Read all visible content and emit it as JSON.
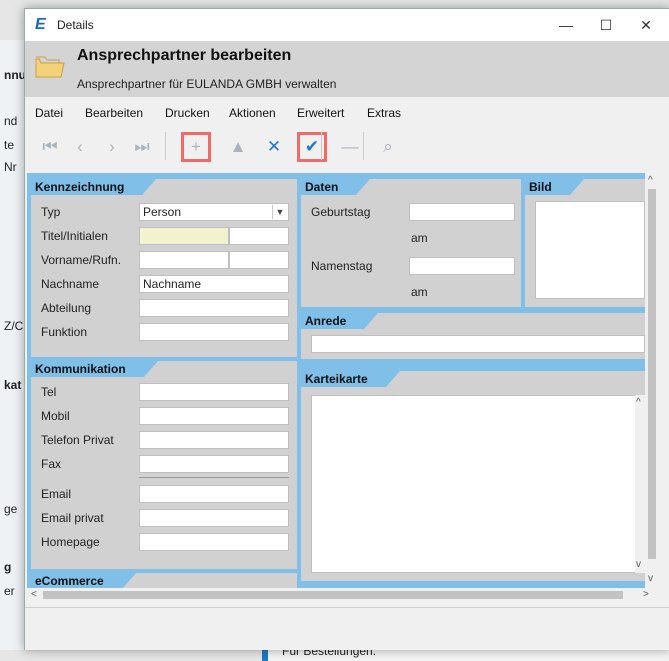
{
  "window": {
    "title": "Details",
    "header_title": "Ansprechpartner bearbeiten",
    "header_subtitle": "Ansprechpartner für EULANDA GMBH verwalten"
  },
  "background_fragments": [
    "nnu",
    "nd",
    "te",
    "Nr",
    "Z/C",
    "kat",
    "ge",
    "g",
    "er"
  ],
  "background_bottom_text": "Für Bestellungen:",
  "menu": [
    {
      "label": "Datei"
    },
    {
      "label": "Bearbeiten"
    },
    {
      "label": "Drucken"
    },
    {
      "label": "Aktionen"
    },
    {
      "label": "Erweitert"
    },
    {
      "label": "Extras"
    }
  ],
  "toolbar": [
    {
      "name": "first-record-icon",
      "glyph": "⏮",
      "enabled": false,
      "highlight": false
    },
    {
      "name": "previous-record-icon",
      "glyph": "‹",
      "enabled": false,
      "highlight": false
    },
    {
      "name": "next-record-icon",
      "glyph": "›",
      "enabled": false,
      "highlight": false
    },
    {
      "name": "last-record-icon",
      "glyph": "⏭",
      "enabled": false,
      "highlight": false
    },
    {
      "name": "add-icon",
      "glyph": "+",
      "enabled": false,
      "highlight": true
    },
    {
      "name": "up-icon",
      "glyph": "▲",
      "enabled": false,
      "highlight": false
    },
    {
      "name": "cancel-icon",
      "glyph": "✕",
      "enabled": true,
      "highlight": false
    },
    {
      "name": "save-check-icon",
      "glyph": "✔",
      "enabled": true,
      "highlight": true
    },
    {
      "name": "delete-minus-icon",
      "glyph": "—",
      "enabled": false,
      "highlight": false
    },
    {
      "name": "search-binoculars-icon",
      "glyph": "⌕",
      "enabled": false,
      "highlight": false
    }
  ],
  "kennzeichnung": {
    "tab": "Kennzeichnung",
    "typ_label": "Typ",
    "typ_value": "Person",
    "titel_label": "Titel/Initialen",
    "vorname_label": "Vorname/Rufn.",
    "nachname_label": "Nachname",
    "nachname_value": "Nachname",
    "abteilung_label": "Abteilung",
    "funktion_label": "Funktion"
  },
  "kommunikation": {
    "tab": "Kommunikation",
    "tel": "Tel",
    "mobil": "Mobil",
    "telefon_privat": "Telefon Privat",
    "fax": "Fax",
    "email": "Email",
    "email_privat": "Email privat",
    "homepage": "Homepage"
  },
  "ecommerce": {
    "tab": "eCommerce"
  },
  "daten": {
    "tab": "Daten",
    "geburtstag": "Geburtstag",
    "am1": "am",
    "namenstag": "Namenstag",
    "am2": "am"
  },
  "bild": {
    "tab": "Bild"
  },
  "anrede": {
    "tab": "Anrede"
  },
  "karteikarte": {
    "tab": "Karteikarte"
  },
  "colors": {
    "accent": "#7fbfe8",
    "panel": "#d1d1d1",
    "highlight": "#f06a6a",
    "field_yellow": "#f2f2cf"
  }
}
